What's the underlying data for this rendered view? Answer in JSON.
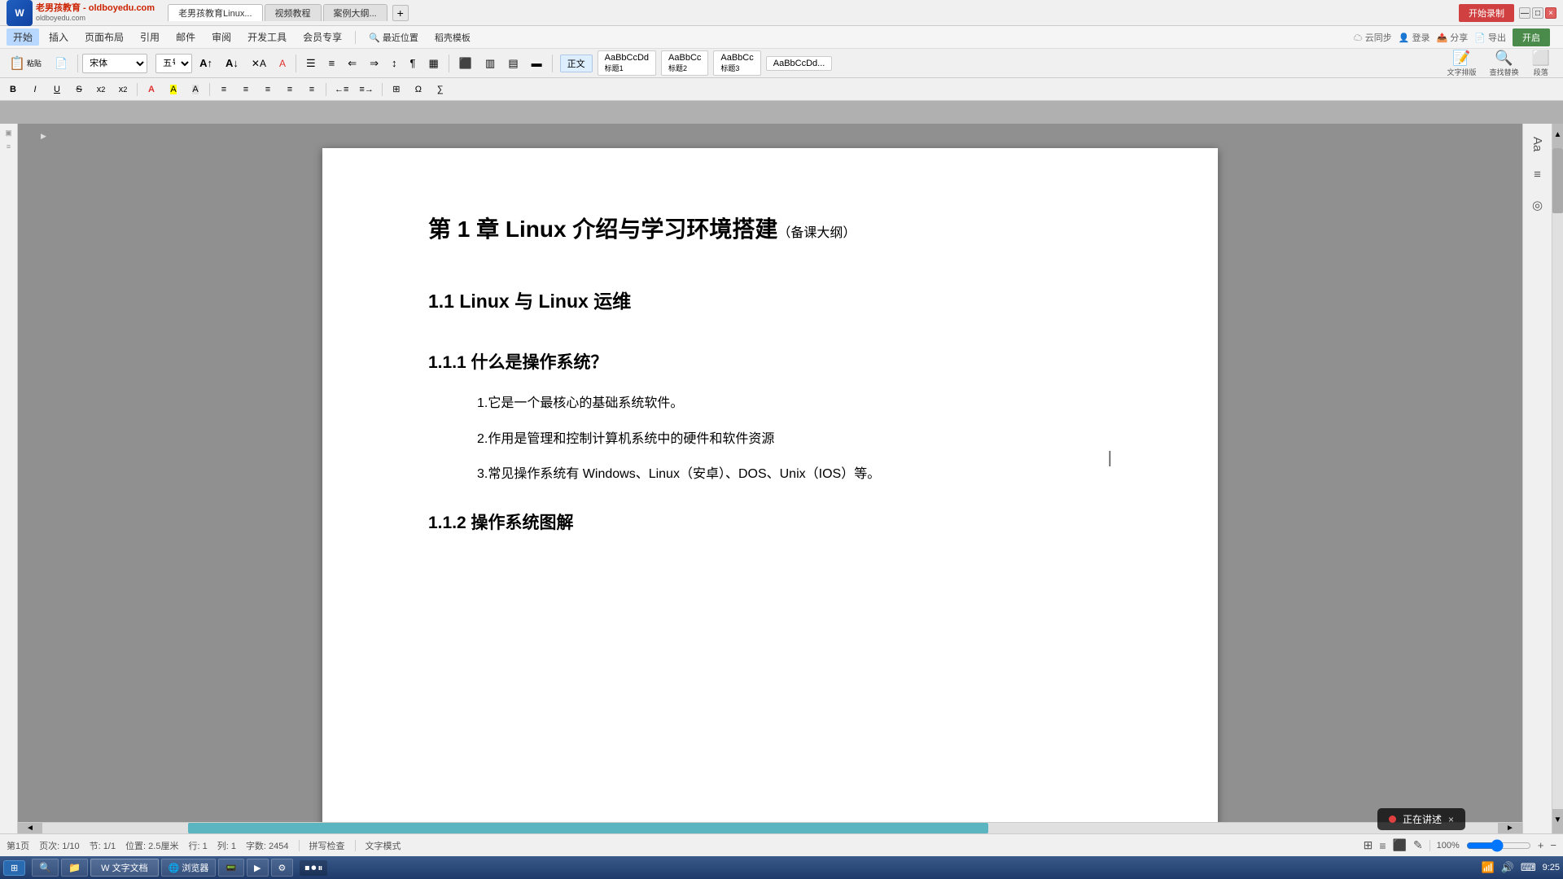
{
  "app": {
    "title": "老男孩教育 - oldboyedu.com",
    "logo_text": "老男孩教育\noldboyedu.com"
  },
  "title_bar": {
    "tabs": [
      {
        "label": "老男孩教育Linux...",
        "active": true
      },
      {
        "label": "视频教程",
        "active": false
      },
      {
        "label": "案例大纲...",
        "active": false
      }
    ],
    "window_buttons": [
      "—",
      "□",
      "×"
    ]
  },
  "menu_bar": {
    "items": [
      "开始",
      "插入",
      "页面布局",
      "引用",
      "邮件",
      "审阅",
      "开发工具",
      "会员专享",
      "Q 最近位置",
      "稻壳模板"
    ]
  },
  "toolbar": {
    "font_name": "宋体",
    "font_size": "五号",
    "style_presets": [
      "正文",
      "标题1",
      "标题2",
      "标题3",
      "AaBbCcDd..."
    ],
    "tools_right": [
      "文字排版",
      "查找替换",
      "段落"
    ]
  },
  "format_toolbar": {
    "bold": "B",
    "italic": "I",
    "underline": "U",
    "strikethrough": "S",
    "superscript": "x²",
    "subscript": "x₂",
    "font_color": "A",
    "highlight": "A",
    "align_left": "≡",
    "align_center": "≡",
    "align_right": "≡",
    "justify": "≡",
    "indent_dec": "←",
    "indent_inc": "→"
  },
  "document": {
    "chapter_title": "第 1 章    Linux 介绍与学习环境搭建",
    "chapter_note": "（备课大纲）",
    "section_1_1": "1.1 Linux 与 Linux 运维",
    "section_1_1_1": "1.1.1  什么是操作系统？",
    "list_items": [
      "1.它是一个最核心的基础系统软件。",
      "2.作用是管理和控制计算机系统中的硬件和软件资源",
      "3.常见操作系统有 Windows、Linux（安卓）、DOS、Unix（IOS）等。"
    ],
    "section_1_1_2": "1.1.2  操作系统图解"
  },
  "status_bar": {
    "page_info": "第1页",
    "page_total": "页次: 1/10",
    "section": "节: 1/1",
    "position": "位置: 2.5厘米",
    "line": "行: 1",
    "column": "列: 1",
    "word_count": "字数: 2454",
    "spelling": "拼写检查",
    "input_mode": "文字模式",
    "zoom": "100%"
  },
  "taskbar": {
    "start_btn": "⊞",
    "apps": [
      "文档",
      "浏览器",
      "文件管理",
      "终端"
    ],
    "time": "9:25",
    "date": ""
  },
  "recording": {
    "label": "正在讲述"
  },
  "top_right": {
    "red_btn": "开始录制",
    "open_btn": "开启"
  },
  "right_panel": {
    "items": [
      "Aa",
      "≡",
      "◎"
    ]
  },
  "scrollbar": {
    "label": ""
  }
}
